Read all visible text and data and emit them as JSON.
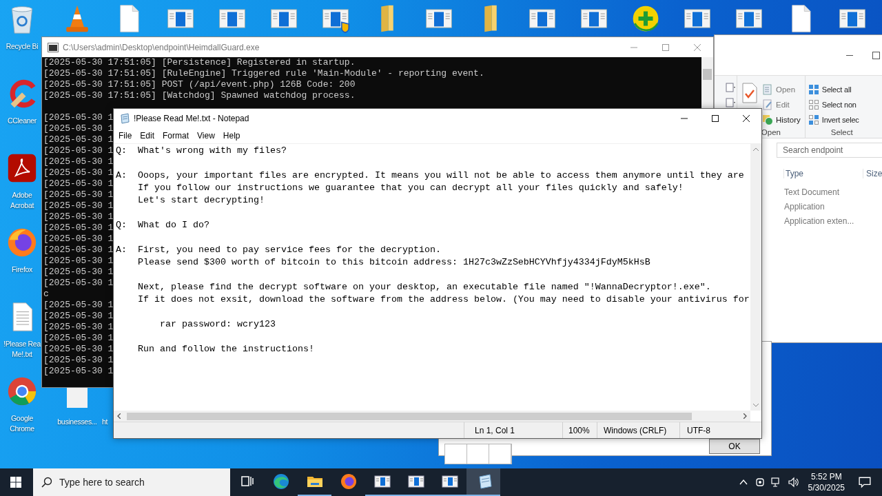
{
  "desktop": {
    "top_icons": [
      {
        "kind": "cone"
      },
      {
        "kind": "file"
      },
      {
        "kind": "app"
      },
      {
        "kind": "app"
      },
      {
        "kind": "app"
      },
      {
        "kind": "shield"
      },
      {
        "kind": "folder"
      },
      {
        "kind": "app"
      },
      {
        "kind": "folder"
      },
      {
        "kind": "app"
      },
      {
        "kind": "app"
      },
      {
        "kind": "plus"
      },
      {
        "kind": "app"
      },
      {
        "kind": "app"
      },
      {
        "kind": "file"
      },
      {
        "kind": "app"
      }
    ],
    "icons": [
      {
        "kind": "recycle",
        "label": [
          "Recycle Bi"
        ]
      },
      {
        "kind": "ccleaner",
        "label": [
          "CCleaner"
        ]
      },
      {
        "kind": "acrobat",
        "label": [
          "Adobe",
          "Acrobat"
        ]
      },
      {
        "kind": "firefox",
        "label": [
          "Firefox"
        ]
      },
      {
        "kind": "text",
        "label": [
          "!Please Rea",
          "Me!.txt"
        ]
      },
      {
        "kind": "chrome",
        "label": [
          "Google",
          "Chrome"
        ]
      }
    ],
    "bottom_icons": [
      {
        "kind": "blank",
        "label": "businesses..."
      },
      {
        "kind": "none",
        "label": "ht"
      }
    ]
  },
  "console": {
    "title": "C:\\Users\\admin\\Desktop\\endpoint\\HeimdallGuard.exe",
    "lines": [
      "[2025-05-30 17:51:05] [Persistence] Registered in startup.",
      "[2025-05-30 17:51:05] [RuleEngine] Triggered rule 'Main-Module' - reporting event.",
      "[2025-05-30 17:51:05] POST (/api/event.php) 126B Code: 200",
      "[2025-05-30 17:51:05] [Watchdog] Spawned watchdog process."
    ],
    "cut_lines": [
      "[2025-05-30 1",
      "[2025-05-30 1",
      "[2025-05-30 1",
      "[2025-05-30 1",
      "[2025-05-30 1",
      "[2025-05-30 1",
      "[2025-05-30 1",
      "[2025-05-30 1",
      "[2025-05-30 1",
      "[2025-05-30 1",
      "[2025-05-30 1",
      "[2025-05-30 1",
      "[2025-05-30 1",
      "[2025-05-30 1",
      "[2025-05-30 1",
      "[2025-05-30 1",
      "c",
      "[2025-05-30 1",
      "[2025-05-30 1",
      "[2025-05-30 1",
      "[2025-05-30 1",
      "[2025-05-30 1",
      "[2025-05-30 1",
      "[2025-05-30 1"
    ]
  },
  "explorer": {
    "open_items": [
      {
        "kind": "open",
        "label": "Open"
      },
      {
        "kind": "edit",
        "label": "Edit"
      },
      {
        "kind": "history",
        "label": "History"
      }
    ],
    "open_group": "Open",
    "select_items": [
      {
        "kind": "all",
        "label": "Select all"
      },
      {
        "kind": "none",
        "label": "Select non"
      },
      {
        "kind": "invert",
        "label": "Invert selec"
      }
    ],
    "select_group": "Select",
    "search": {
      "placeholder": "Search endpoint"
    },
    "columns": [
      "Type",
      "Size"
    ],
    "rows": [
      "Text Document",
      "Application",
      "Application exten..."
    ]
  },
  "notepad": {
    "title": "!Please Read Me!.txt - Notepad",
    "menu": [
      "File",
      "Edit",
      "Format",
      "View",
      "Help"
    ],
    "blocks": [
      {
        "label": "Q:",
        "indent": false,
        "lines": [
          "What's wrong with my files?"
        ]
      },
      {
        "label": "A:",
        "indent": false,
        "lines": [
          "Ooops, your important files are encrypted. It means you will not be able to access them anymore until they are",
          "If you follow our instructions we guarantee that you can decrypt all your files quickly and safely!",
          "Let's start decrypting!"
        ]
      },
      {
        "label": "Q:",
        "indent": false,
        "lines": [
          "What do I do?"
        ]
      },
      {
        "label": "A:",
        "indent": false,
        "lines": [
          "First, you need to pay service fees for the decryption.",
          "Please send $300 worth of bitcoin to this bitcoin address: 1H27c3wZzSebHCYVhfjy4334jFdyM5kHsB"
        ]
      },
      {
        "indent": false,
        "lines": [
          "Next, please find the decrypt software on your desktop, an executable file named \"!WannaDecryptor!.exe\".",
          "If it does not exsit, download the software from the address below. (You may need to disable your antivirus for"
        ]
      },
      {
        "indent": true,
        "lines": [
          "rar password: wcry123"
        ]
      },
      {
        "indent": false,
        "lines": [
          "Run and follow the instructions!"
        ]
      }
    ],
    "status": [
      "Ln 1, Col 1",
      "100%",
      "Windows (CRLF)",
      "UTF-8"
    ]
  },
  "dialog": {
    "button": "OK"
  },
  "taskbar": {
    "search_placeholder": "Type here to search",
    "apps": [
      {
        "kind": "taskview",
        "running": false,
        "selected": false
      },
      {
        "kind": "edge",
        "running": false,
        "selected": false
      },
      {
        "kind": "folder",
        "running": true,
        "selected": false
      },
      {
        "kind": "firefox",
        "running": false,
        "selected": false
      },
      {
        "kind": "app",
        "running": true,
        "selected": false
      },
      {
        "kind": "app",
        "running": true,
        "selected": false
      },
      {
        "kind": "app",
        "running": true,
        "selected": false
      },
      {
        "kind": "notepad",
        "running": true,
        "selected": true
      }
    ],
    "time": "5:52 PM",
    "date": "5/30/2025"
  }
}
